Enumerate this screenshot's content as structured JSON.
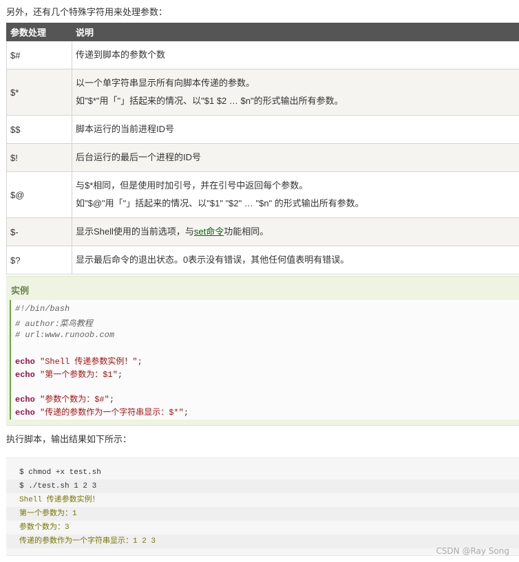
{
  "intro": "另外，还有几个特殊字符用来处理参数：",
  "table": {
    "headers": [
      "参数处理",
      "说明"
    ],
    "rows": [
      {
        "param": "$#",
        "lines": [
          "传递到脚本的参数个数"
        ]
      },
      {
        "param": "$*",
        "lines": [
          "以一个单字符串显示所有向脚本传递的参数。",
          "如\"$*\"用「\"」括起来的情况、以\"$1 $2 … $n\"的形式输出所有参数。"
        ]
      },
      {
        "param": "$$",
        "lines": [
          "脚本运行的当前进程ID号"
        ]
      },
      {
        "param": "$!",
        "lines": [
          "后台运行的最后一个进程的ID号"
        ]
      },
      {
        "param": "$@",
        "lines": [
          "与$*相同，但是使用时加引号，并在引号中返回每个参数。",
          "如\"$@\"用「\"」括起来的情况、以\"$1\" \"$2\" … \"$n\" 的形式输出所有参数。"
        ]
      },
      {
        "param": "$-",
        "desc_before": "显示Shell使用的当前选项，与",
        "desc_link": "set命令",
        "desc_after": "功能相同。"
      },
      {
        "param": "$?",
        "lines": [
          "显示最后命令的退出状态。0表示没有错误，其他任何值表明有错误。"
        ]
      }
    ]
  },
  "example": {
    "title": "实例",
    "comments": [
      "#!/bin/bash",
      "# author:菜鸟教程",
      "# url:www.runoob.com"
    ],
    "statements": [
      {
        "kw": "echo",
        "str": "\"Shell 传递参数实例！\"",
        "end": ";"
      },
      {
        "kw": "echo",
        "str": "\"第一个参数为：$1\"",
        "end": ";"
      },
      {
        "kw": "echo",
        "str": "\"参数个数为：$#\"",
        "end": ";"
      },
      {
        "kw": "echo",
        "str": "\"传递的参数作为一个字符串显示：$*\"",
        "end": ";"
      }
    ]
  },
  "run_text": "执行脚本，输出结果如下所示：",
  "output_lines": [
    "$ chmod +x test.sh",
    "$ ./test.sh 1 2 3",
    "Shell 传递参数实例！",
    "第一个参数为：1",
    "参数个数为：3",
    "传递的参数作为一个字符串显示：1 2 3"
  ],
  "watermark": "CSDN @Ray Song"
}
